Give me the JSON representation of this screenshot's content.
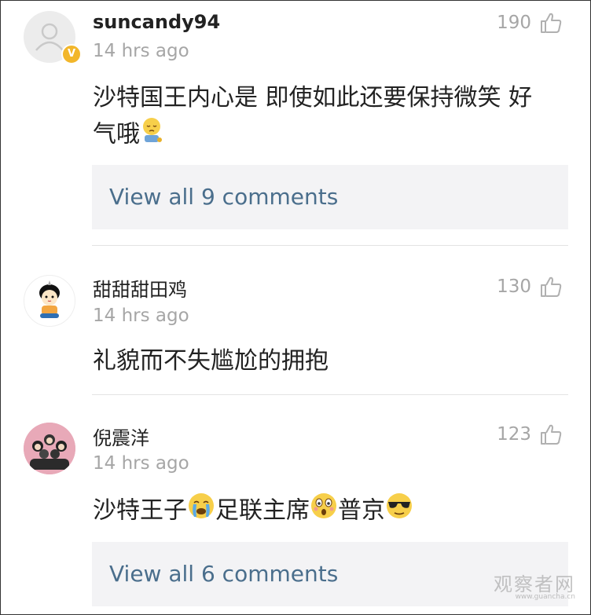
{
  "comments": [
    {
      "username": "suncandy94",
      "time": "14 hrs ago",
      "likes": "190",
      "verified": true,
      "text_line1": "沙特国王内心是 即使如此还要保持微笑 好",
      "text_line2": "气哦",
      "emoji": "pensive-face-emoji",
      "view_all": "View all 9 comments"
    },
    {
      "username": "甜甜甜田鸡",
      "time": "14 hrs ago",
      "likes": "130",
      "text": "礼貌而不失尴尬的拥抱"
    },
    {
      "username": "倪震洋",
      "time": "14 hrs ago",
      "likes": "123",
      "text_parts": [
        "沙特王子",
        "足联主席",
        "普京"
      ],
      "emojis": [
        "crying-face-emoji",
        "astonished-face-emoji",
        "sunglasses-face-emoji"
      ],
      "view_all": "View all 6 comments"
    }
  ],
  "watermark": {
    "text": "观察者网",
    "url": "www.guancha.cn"
  },
  "colors": {
    "link": "#4a6e8c",
    "muted": "#a6a6a6",
    "panel": "#f3f3f5"
  }
}
